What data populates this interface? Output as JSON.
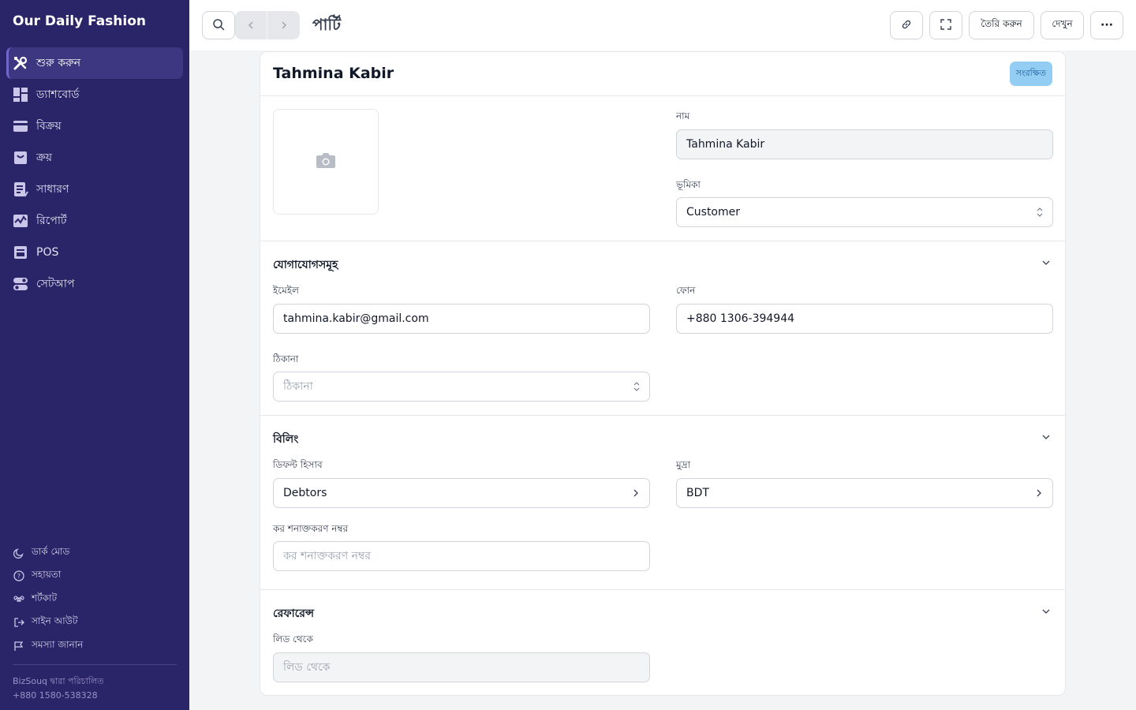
{
  "app": {
    "brand": "Our Daily Fashion"
  },
  "sidebar": {
    "items": [
      {
        "label": "শুরু করুন",
        "icon": "tools-icon",
        "active": true
      },
      {
        "label": "ড্যাশবোর্ড",
        "icon": "dashboard-icon"
      },
      {
        "label": "বিক্রয়",
        "icon": "sales-icon"
      },
      {
        "label": "ক্রয়",
        "icon": "purchase-icon"
      },
      {
        "label": "সাধারণ",
        "icon": "common-icon"
      },
      {
        "label": "রিপোর্ট",
        "icon": "reports-icon"
      },
      {
        "label": "POS",
        "icon": "pos-icon"
      },
      {
        "label": "সেটআপ",
        "icon": "setup-icon"
      }
    ],
    "bottom": [
      {
        "label": "ডার্ক মোড",
        "icon": "moon-icon"
      },
      {
        "label": "সহায়তা",
        "icon": "help-icon"
      },
      {
        "label": "শর্টকাট",
        "icon": "command-icon"
      },
      {
        "label": "সাইন আউট",
        "icon": "sign-out-icon"
      },
      {
        "label": "সমস্যা জানান",
        "icon": "flag-icon"
      }
    ],
    "powered_by": "BizSouq দ্বারা পরিচালিত",
    "phone": "+880 1580-538328"
  },
  "topbar": {
    "title": "পার্টি",
    "create_label": "তৈরি করুন",
    "view_label": "দেখুন",
    "more_label": "···"
  },
  "party": {
    "name": "Tahmina Kabir",
    "status": "সংরক্ষিত",
    "fields": {
      "name_label": "নাম",
      "name_value": "Tahmina Kabir",
      "role_label": "ভূমিকা",
      "role_value": "Customer"
    }
  },
  "contacts": {
    "title": "যোগাযোগসমূহ",
    "email_label": "ইমেইল",
    "email_value": "tahmina.kabir@gmail.com",
    "phone_label": "ফোন",
    "phone_value": "+880 1306-394944",
    "address_label": "ঠিকানা",
    "address_placeholder": "ঠিকানা"
  },
  "billing": {
    "title": "বিলিং",
    "account_label": "ডিফল্ট হিসাব",
    "account_value": "Debtors",
    "currency_label": "মুদ্রা",
    "currency_value": "BDT",
    "tax_label": "কর শনাক্তকরণ নম্বর",
    "tax_placeholder": "কর শনাক্তকরণ নম্বর"
  },
  "references": {
    "title": "রেফারেন্স",
    "lead_label": "লিড থেকে",
    "lead_placeholder": "লিড থেকে"
  },
  "colors": {
    "sidebar_bg": "#2a2468",
    "sidebar_active": "#3d3782",
    "badge_bg": "#93cdf3",
    "badge_text": "#1d5e9c"
  }
}
